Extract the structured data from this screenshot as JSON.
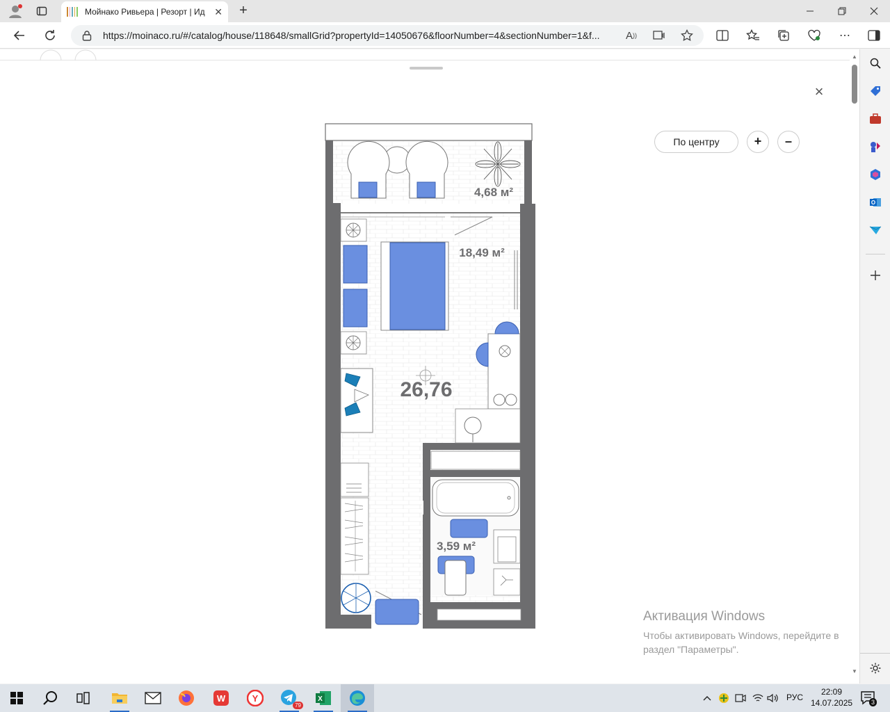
{
  "browser": {
    "tab_title": "Мойнако Ривьера | Резорт | Ид",
    "url": "https://moinaco.ru/#/catalog/house/118648/smallGrid?propertyId=14050676&floorNumber=4&sectionNumber=1&f..."
  },
  "plan": {
    "controls": {
      "center_label": "По центру",
      "zoom_in": "+",
      "zoom_out": "–",
      "close": "×"
    },
    "areas": {
      "balcony": "4,68 м²",
      "room": "18,49 м²",
      "total": "26,76",
      "bathroom": "3,59 м²"
    },
    "colors": {
      "wall": "#6d6d6f",
      "furniture": "#6a8fe0",
      "accent_teal": "#1b7fb8"
    }
  },
  "watermark": {
    "title": "Активация Windows",
    "text": "Чтобы активировать Windows, перейдите в раздел \"Параметры\"."
  },
  "taskbar": {
    "language": "РУС",
    "time": "22:09",
    "date": "14.07.2025",
    "telegram_badge": "79",
    "notification_count": "3"
  }
}
